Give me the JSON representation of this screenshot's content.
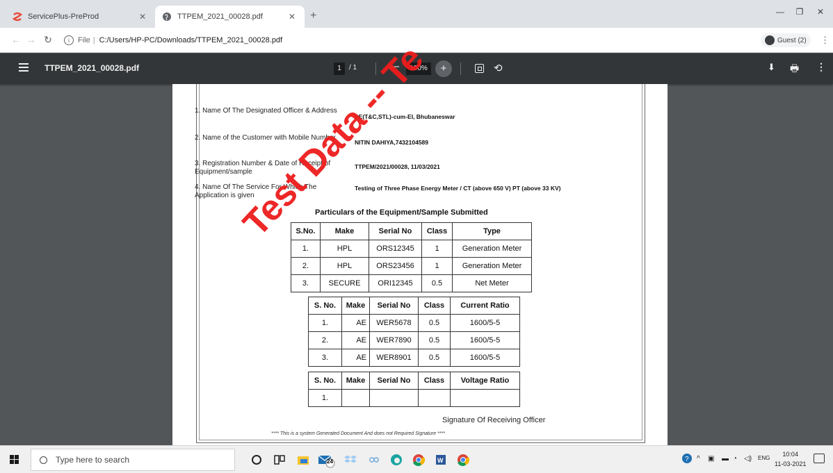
{
  "browser": {
    "tabs": [
      {
        "title": "ServicePlus-PreProd",
        "active": false,
        "favicon_color": "#e74c3c"
      },
      {
        "title": "TTPEM_2021_00028.pdf",
        "active": true,
        "favicon_color": "#5f6368"
      }
    ],
    "address": {
      "scheme": "File",
      "path": "C:/Users/HP-PC/Downloads/TTPEM_2021_00028.pdf"
    },
    "profile_label": "Guest (2)"
  },
  "pdf_viewer": {
    "filename": "TTPEM_2021_00028.pdf",
    "current_page": "1",
    "total_pages": "/ 1",
    "zoom": "100%"
  },
  "document": {
    "info": [
      {
        "label": "1. Name Of The Designated Officer & Address",
        "value": "SE(T&C,STL)-cum-EI, Bhubaneswar"
      },
      {
        "label": "2. Name of the Customer with Mobile Number",
        "value": "NITIN DAHIYA,7432104589"
      },
      {
        "label": "3. Registration Number & Date of Receipt of Equipment/sample",
        "value": "TTPEM/2021/00028, 11/03/2021"
      },
      {
        "label": "4. Name Of The Service For Which The Application is given",
        "value": "Testing of Three Phase Energy Meter / CT (above 650 V) PT (above 33 KV)"
      }
    ],
    "section_title": "Particulars of the Equipment/Sample Submitted",
    "meter_table": {
      "headers": [
        "S.No.",
        "Make",
        "Serial No",
        "Class",
        "Type"
      ],
      "rows": [
        [
          "1.",
          "HPL",
          "ORS12345",
          "1",
          "Generation Meter"
        ],
        [
          "2.",
          "HPL",
          "ORS23456",
          "1",
          "Generation Meter"
        ],
        [
          "3.",
          "SECURE",
          "ORI12345",
          "0.5",
          "Net Meter"
        ]
      ]
    },
    "ct_table": {
      "headers": [
        "S. No.",
        "Make",
        "Serial No",
        "Class",
        "Current Ratio"
      ],
      "rows": [
        [
          "1.",
          "AE",
          "WER5678",
          "0.5",
          "1600/5-5"
        ],
        [
          "2.",
          "AE",
          "WER7890",
          "0.5",
          "1600/5-5"
        ],
        [
          "3.",
          "AE",
          "WER8901",
          "0.5",
          "1600/5-5"
        ]
      ]
    },
    "pt_table": {
      "headers": [
        "S. No.",
        "Make",
        "Serial No",
        "Class",
        "Voltage Ratio"
      ],
      "rows": [
        [
          "1.",
          "",
          "",
          "",
          ""
        ]
      ]
    },
    "signature_label": "Signature Of Receiving Officer",
    "footer_note": "**** This is a system Generated Document And does not Required Signature ****",
    "watermark": "Test Data -- Te",
    "watermark_color": "#ee1c1c"
  },
  "taskbar": {
    "search_placeholder": "Type here to search",
    "mail_badge": "24",
    "language": "ENG",
    "time": "10:04",
    "date": "11-03-2021"
  }
}
